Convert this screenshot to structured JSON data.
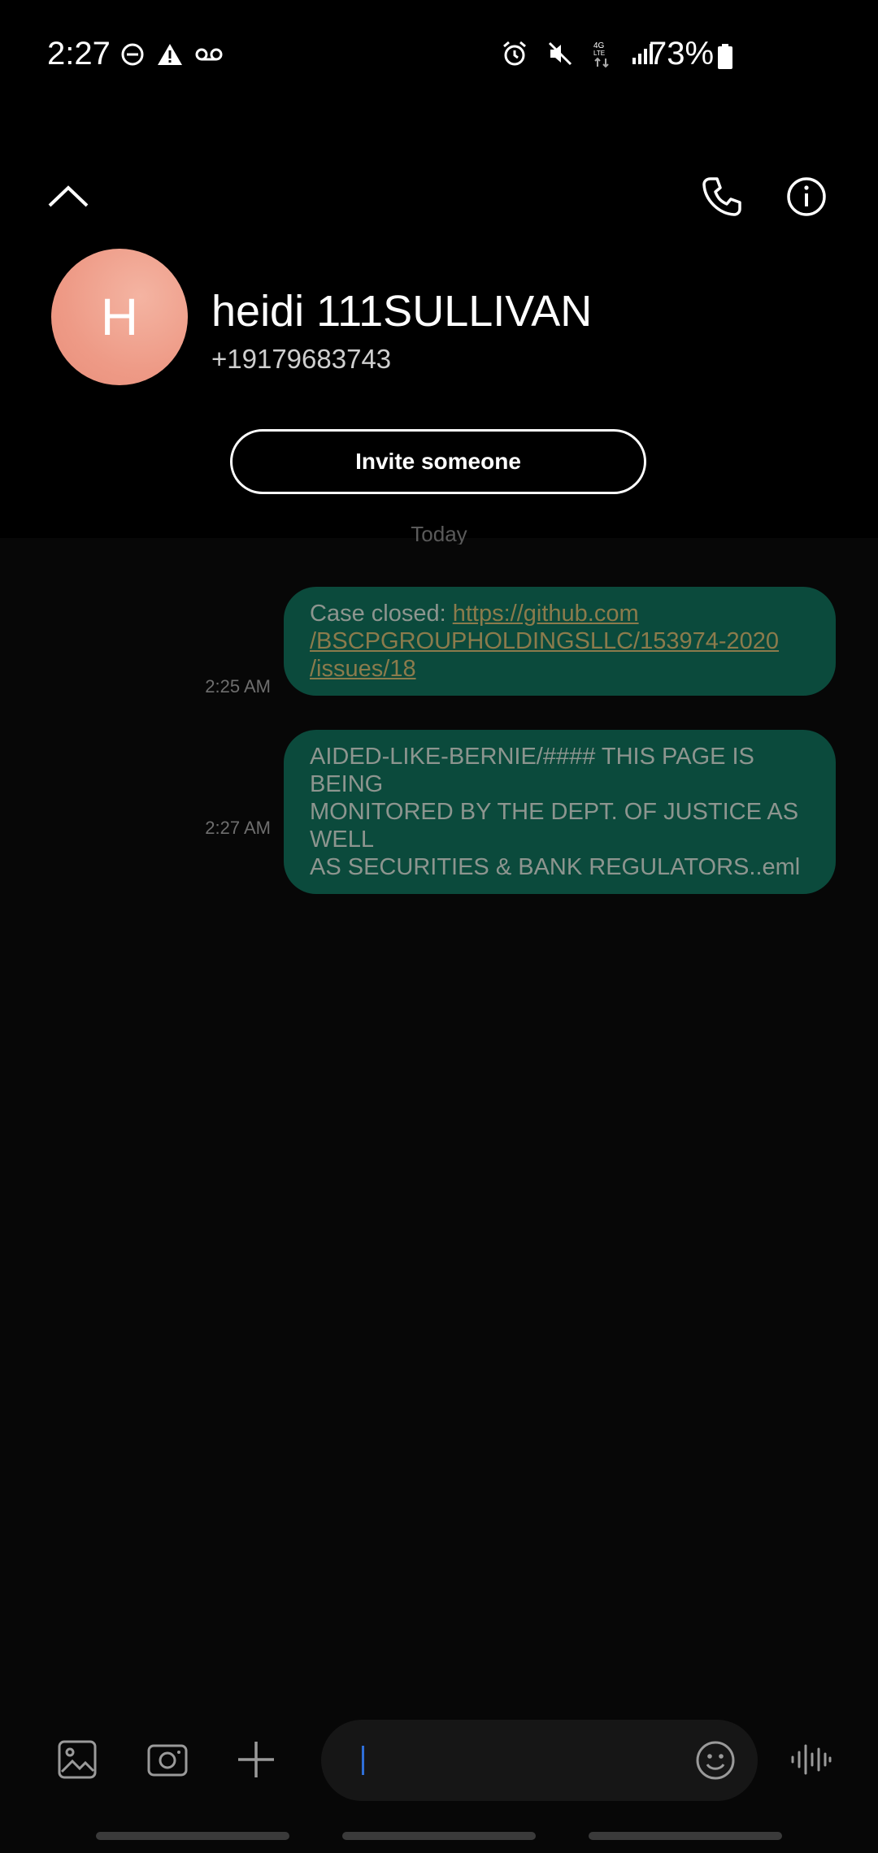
{
  "status_bar": {
    "time": "2:27",
    "left_icons": [
      "do-not-disturb-icon",
      "alert-icon",
      "voicemail-icon"
    ],
    "right_icons": [
      "alarm-icon",
      "mute-icon",
      "4g-lte-icon",
      "signal-icon"
    ],
    "battery_percent": "73%"
  },
  "header": {
    "avatar_initial": "H",
    "contact_name": "heidi 111SULLIVAN",
    "contact_phone": "+19179683743",
    "invite_label": "Invite someone"
  },
  "conversation": {
    "date_divider": "Today",
    "messages": [
      {
        "time": "2:25 AM",
        "prefix": "Case closed: ",
        "link_lines": [
          "https://github.com",
          "/BSCPGROUPHOLDINGSLLC/153974-2020",
          "/issues/18"
        ]
      },
      {
        "time": "2:27 AM",
        "lines": [
          "AIDED-LIKE-BERNIE/#### THIS PAGE IS BEING",
          "MONITORED BY THE DEPT. OF JUSTICE AS WELL",
          "AS SECURITIES & BANK REGULATORS..eml"
        ]
      }
    ]
  },
  "composer": {
    "input_value": "",
    "icons": [
      "gallery-icon",
      "camera-icon",
      "add-icon",
      "emoji-icon",
      "voice-icon"
    ]
  },
  "colors": {
    "bubble": "#0b4a3c",
    "link": "#8b7b4c",
    "avatar": "#ee9a86"
  }
}
